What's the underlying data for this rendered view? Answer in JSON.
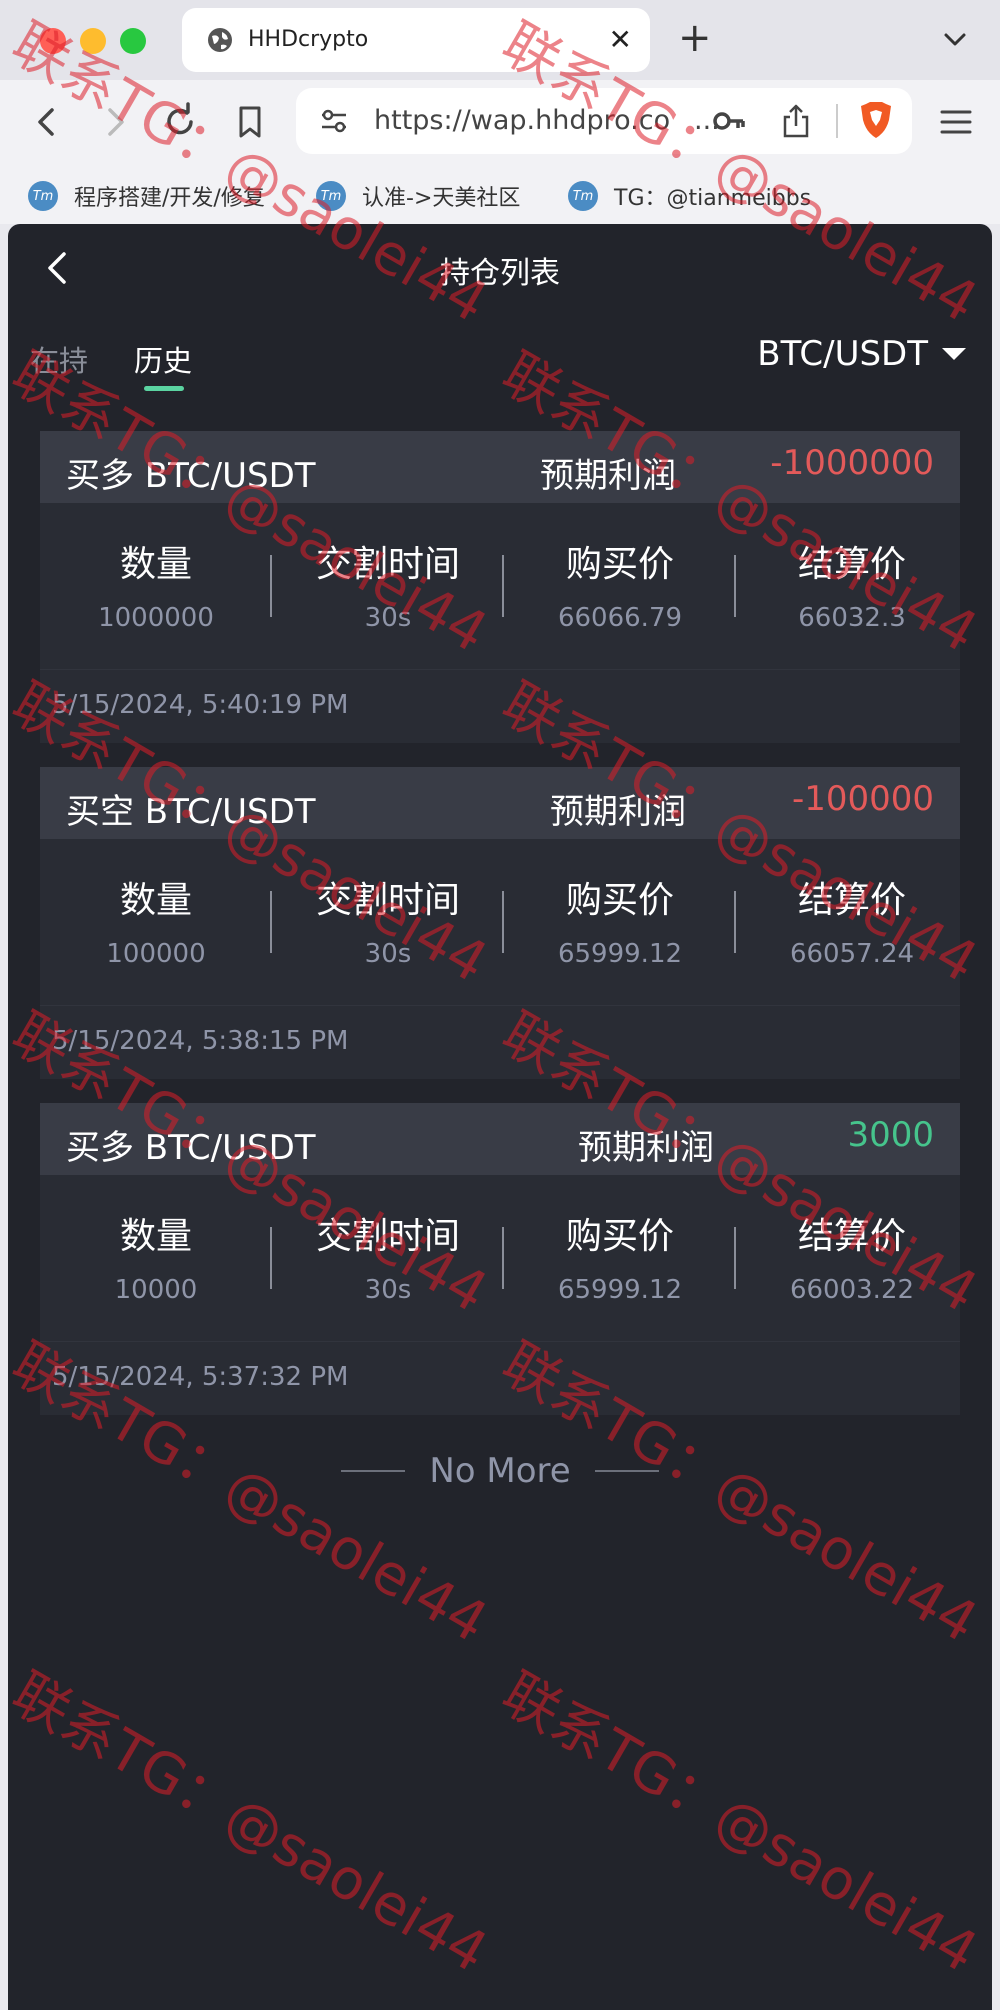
{
  "browser": {
    "tab_title": "HHDcrypto",
    "url": "https://wap.hhdpro.co",
    "url_ellipsis": "...",
    "bookmarks": [
      {
        "favicon": "Tm",
        "label": "程序搭建/开发/修复"
      },
      {
        "favicon": "Tm",
        "label": "认准->天美社区"
      },
      {
        "favicon": "Tm",
        "label": "TG：@tianmeibbs"
      }
    ]
  },
  "app": {
    "page_title": "持仓列表",
    "tabs": [
      {
        "label": "在持",
        "active": false
      },
      {
        "label": "历史",
        "active": true
      }
    ],
    "pair": "BTC/USDT",
    "profit_label": "预期利润",
    "column_labels": {
      "quantity": "数量",
      "delivery_time": "交割时间",
      "buy_price": "购买价",
      "settle_price": "结算价"
    },
    "positions": [
      {
        "side": "买多 BTC/USDT",
        "profit": "-1000000",
        "profit_sign": "negative",
        "quantity": "1000000",
        "delivery_time": "30s",
        "buy_price": "66066.79",
        "settle_price": "66032.3",
        "timestamp": "5/15/2024, 5:40:19 PM"
      },
      {
        "side": "买空 BTC/USDT",
        "profit": "-100000",
        "profit_sign": "negative",
        "quantity": "100000",
        "delivery_time": "30s",
        "buy_price": "65999.12",
        "settle_price": "66057.24",
        "timestamp": "5/15/2024, 5:38:15 PM"
      },
      {
        "side": "买多 BTC/USDT",
        "profit": "3000",
        "profit_sign": "positive",
        "quantity": "10000",
        "delivery_time": "30s",
        "buy_price": "65999.12",
        "settle_price": "66003.22",
        "timestamp": "5/15/2024, 5:37:32 PM"
      }
    ],
    "no_more": "No More"
  },
  "watermark": {
    "text": "联系TG：@saolei44"
  },
  "colors": {
    "negative": "#e35a5a",
    "positive": "#46c48c",
    "tab_underline": "#5bd3a1",
    "app_bg": "#22242b",
    "card_head_bg": "#393c46"
  },
  "icons": [
    "globe-icon",
    "close-icon",
    "plus-icon",
    "chevron-down-icon",
    "back-icon",
    "forward-icon",
    "reload-icon",
    "bookmark-icon",
    "site-settings-icon",
    "key-icon",
    "share-icon",
    "brave-shield-icon",
    "menu-icon",
    "caret-down-icon"
  ]
}
